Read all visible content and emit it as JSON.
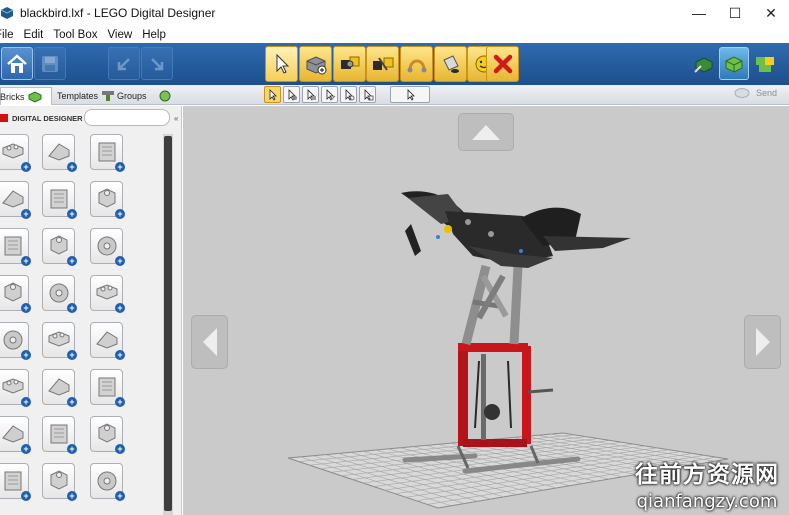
{
  "window": {
    "title": "blackbird.lxf - LEGO Digital Designer",
    "minimize_glyph": "—",
    "maximize_glyph": "☐",
    "close_glyph": "✕"
  },
  "menu": {
    "items": [
      "File",
      "Edit",
      "Tool Box",
      "View",
      "Help"
    ]
  },
  "toolbar": {
    "mode_icons": [
      "build-mode-icon",
      "view-mode-icon",
      "build-guide-icon"
    ]
  },
  "tabs": {
    "bricks": "Bricks",
    "templates": "Templates",
    "groups": "Groups"
  },
  "subbar": {
    "send_label": "Send"
  },
  "sidebar": {
    "brand": "DIGITAL DESIGNER",
    "search_value": ""
  },
  "bricks_count_visible": 24,
  "watermark": {
    "line1": "往前方资源网",
    "line2": "qianfangzy.com"
  },
  "colors": {
    "toolbar_blue": "#1e4f8c",
    "tool_yellow": "#f6cf57",
    "viewport_gray": "#cacaca",
    "model_red": "#c8161d",
    "model_black": "#2a2a2a"
  }
}
